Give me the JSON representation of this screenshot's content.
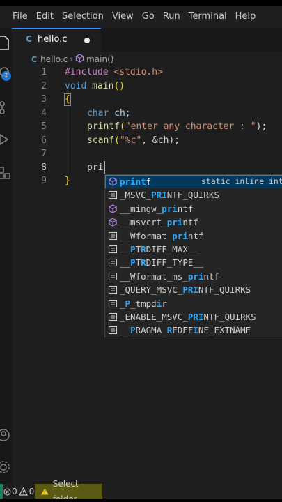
{
  "menu": [
    "File",
    "Edit",
    "Selection",
    "View",
    "Go",
    "Run",
    "Terminal",
    "Help"
  ],
  "activity": {
    "explorer_badge": "1",
    "icons": [
      "files-icon",
      "search-icon",
      "source-control-icon",
      "run-debug-icon",
      "extensions-icon",
      "account-icon",
      "settings-gear-icon"
    ]
  },
  "tab": {
    "lang_icon_text": "C",
    "label": "hello.c",
    "dirty": true
  },
  "breadcrumb": {
    "lang_icon_text": "C",
    "file": "hello.c",
    "separator": "›",
    "symbol": "main()"
  },
  "editor": {
    "line_numbers": [
      "1",
      "2",
      "3",
      "4",
      "5",
      "6",
      "7",
      "8",
      "9"
    ],
    "active_line": "8",
    "tokens": {
      "l1_directive": "#include",
      "l1_header": " <stdio.h>",
      "l2_type": "void",
      "l2_fn": " main",
      "l2_parens": "()",
      "l3_brace": "{",
      "l4_type": "char",
      "l4_rest": " ch;",
      "l5_fn": "printf",
      "l5_open": "(",
      "l5_str": "\"enter any character : \"",
      "l5_close": ");",
      "l6_fn": "scanf",
      "l6_open": "(",
      "l6_str": "\"%c\"",
      "l6_rest": ", &ch);",
      "l8_typed": "pri",
      "l9_brace": "}"
    }
  },
  "suggestions": {
    "selected_index": 0,
    "items": [
      {
        "kind": "method",
        "pre": "",
        "hl": "print",
        "post": "f",
        "hl2": "",
        "post2": "",
        "detail": "static inline int"
      },
      {
        "kind": "constant",
        "pre": "_MSVC_",
        "hl": "PRI",
        "post": "NTF_QUIRKS",
        "hl2": "",
        "post2": ""
      },
      {
        "kind": "method",
        "pre": "__mingw_",
        "hl": "pri",
        "post": "ntf",
        "hl2": "",
        "post2": ""
      },
      {
        "kind": "method",
        "pre": "__msvcrt_",
        "hl": "pri",
        "post": "ntf",
        "hl2": "",
        "post2": ""
      },
      {
        "kind": "constant",
        "pre": "__Wformat_",
        "hl": "pri",
        "post": "ntf",
        "hl2": "",
        "post2": ""
      },
      {
        "kind": "constant",
        "pre": "__",
        "hl": "P",
        "post": "T",
        "hl2": "R",
        "post2": "DIFF_MAX__"
      },
      {
        "kind": "constant",
        "pre": "__",
        "hl": "P",
        "post": "T",
        "hl2": "R",
        "post2": "DIFF_TYPE__"
      },
      {
        "kind": "constant",
        "pre": "__Wformat_ms_",
        "hl": "pri",
        "post": "ntf",
        "hl2": "",
        "post2": ""
      },
      {
        "kind": "constant",
        "pre": "_QUERY_MSVC_",
        "hl": "PRI",
        "post": "NTF_QUIRKS",
        "hl2": "",
        "post2": ""
      },
      {
        "kind": "constant",
        "pre": "_",
        "hl": "P",
        "post": "_tmpd",
        "hl2": "i",
        "post2": "r"
      },
      {
        "kind": "constant",
        "pre": "_ENABLE_MSVC_",
        "hl": "PRI",
        "post": "NTF_QUIRKS",
        "hl2": "",
        "post2": ""
      },
      {
        "kind": "constant",
        "pre": "__",
        "hl": "P",
        "post": "RAGMA_",
        "hl2": "R",
        "post2": "EDEF",
        "hl3": "I",
        "post3": "NE_EXTNAME"
      }
    ]
  },
  "status": {
    "errors": "0",
    "warnings": "0",
    "folder_warning": "Select folder."
  },
  "colors": {
    "accent": "#3794ff",
    "selected_row": "#04395e",
    "match_highlight": "#2aaaff",
    "method_icon": "#b180d7",
    "folder_warning_bg": "#5a5a14"
  }
}
